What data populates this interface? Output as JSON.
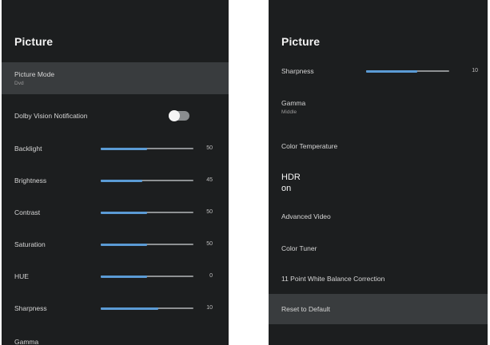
{
  "left_panel": {
    "title": "Picture",
    "picture_mode": {
      "label": "Picture Mode",
      "value": "Dvd"
    },
    "dolby_vision": {
      "label": "Dolby Vision Notification",
      "enabled": false
    },
    "sliders": [
      {
        "label": "Backlight",
        "value": "50",
        "fraction": 0.5
      },
      {
        "label": "Brightness",
        "value": "45",
        "fraction": 0.45
      },
      {
        "label": "Contrast",
        "value": "50",
        "fraction": 0.5
      },
      {
        "label": "Saturation",
        "value": "50",
        "fraction": 0.5
      },
      {
        "label": "HUE",
        "value": "0",
        "fraction": 0.5
      },
      {
        "label": "Sharpness",
        "value": "10",
        "fraction": 0.62
      }
    ],
    "gamma": {
      "label": "Gamma"
    }
  },
  "right_panel": {
    "title": "Picture",
    "sharpness": {
      "label": "Sharpness",
      "value": "10",
      "fraction": 0.62
    },
    "gamma": {
      "label": "Gamma",
      "value": "Middle"
    },
    "color_temperature": {
      "label": "Color Temperature"
    },
    "hdr": {
      "label": "HDR",
      "value": "on"
    },
    "advanced_video": {
      "label": "Advanced Video"
    },
    "color_tuner": {
      "label": "Color Tuner"
    },
    "white_balance": {
      "label": "11 Point White Balance Correction"
    },
    "reset": {
      "label": "Reset to Default"
    }
  },
  "colors": {
    "panel_bg": "#1c1e1f",
    "selected_row_bg": "#393c3e",
    "slider_fill": "#5b9bd5",
    "slider_track": "#8e9193"
  }
}
